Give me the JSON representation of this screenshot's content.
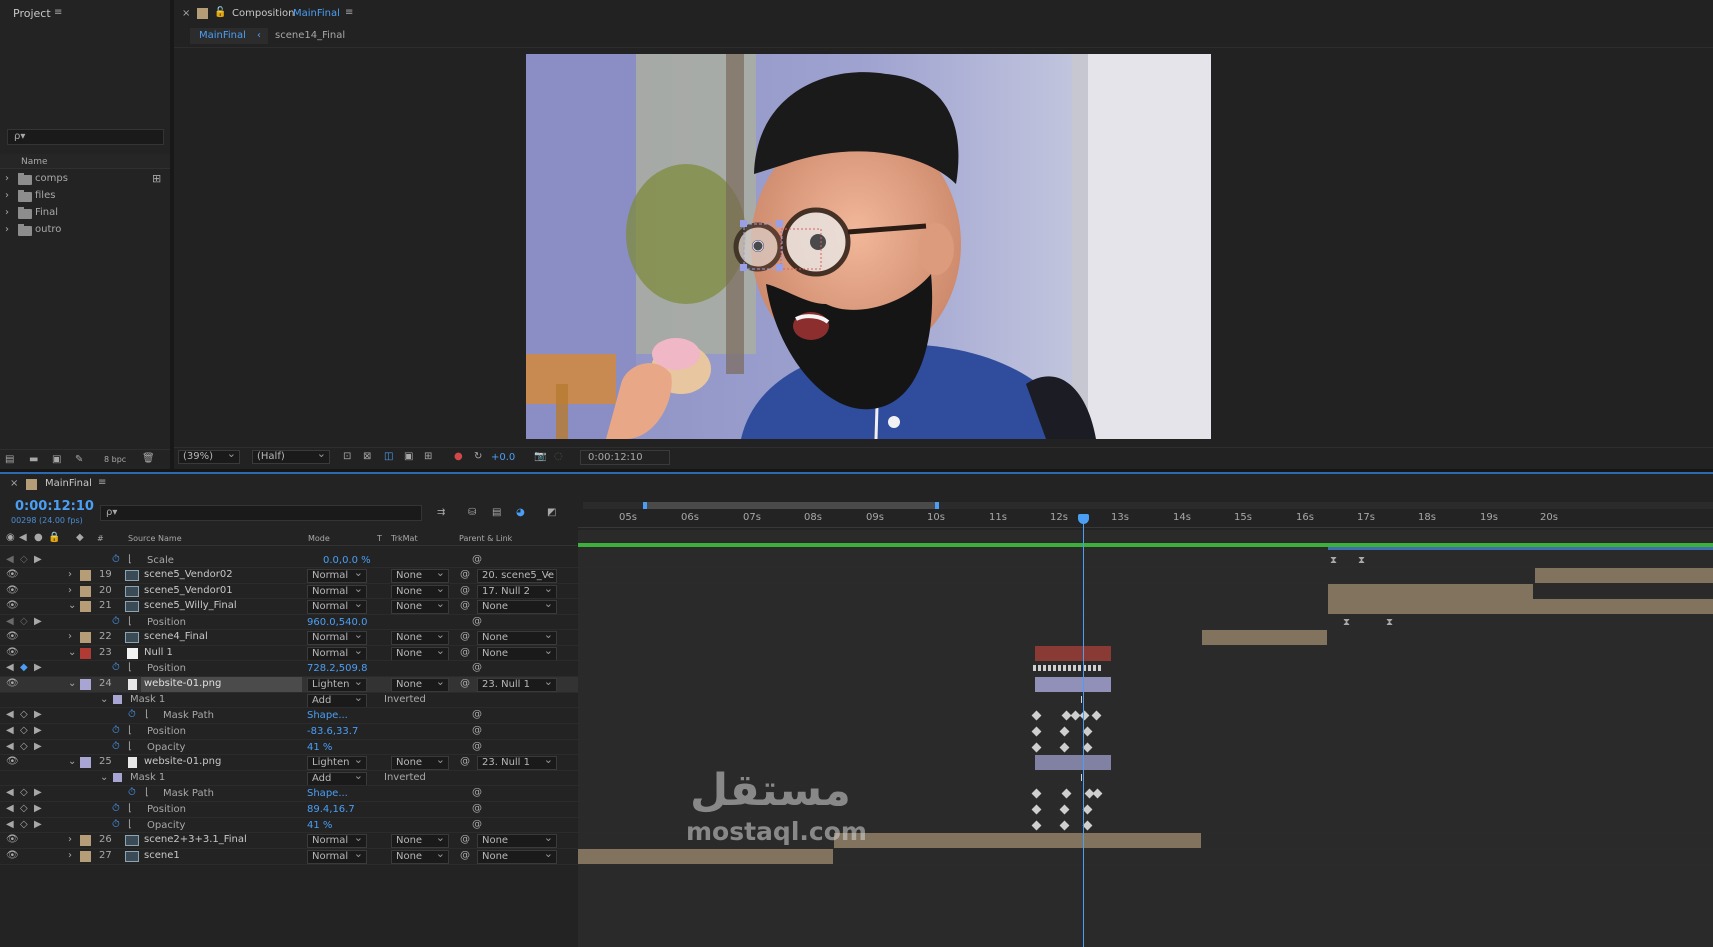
{
  "project": {
    "title": "Project",
    "search_placeholder": "ρ▾",
    "column_name": "Name",
    "items": [
      "comps",
      "files",
      "Final",
      "outro"
    ],
    "bpc": "8 bpc"
  },
  "composition": {
    "close": "×",
    "label": "Composition",
    "name": "MainFinal",
    "menu": "≡",
    "breadcrumb_active": "MainFinal",
    "breadcrumb_arrow": "‹",
    "breadcrumb_next": "scene14_Final",
    "zoom": "(39%)",
    "resolution": "(Half)",
    "exposure": "+0.0",
    "timecode": "0:00:12:10"
  },
  "timeline": {
    "close": "×",
    "tab_name": "MainFinal",
    "menu": "≡",
    "current_time": "0:00:12:10",
    "frames": "00298 (24.00 fps)",
    "search_placeholder": "ρ▾",
    "headers": {
      "number": "#",
      "source_name": "Source Name",
      "mode": "Mode",
      "t": "T",
      "trkmat": "TrkMat",
      "parent": "Parent & Link"
    },
    "ruler": [
      "05s",
      "06s",
      "07s",
      "08s",
      "09s",
      "10s",
      "11s",
      "12s",
      "13s",
      "14s",
      "15s",
      "16s",
      "17s",
      "18s",
      "19s",
      "20s"
    ],
    "rows": [
      {
        "kind": "prop",
        "name": "Scale",
        "value": "0.0,0.0 %"
      },
      {
        "kind": "layer",
        "num": "19",
        "name": "scene5_Vendor02",
        "mode": "Normal",
        "trkmat": "None",
        "parent": "20. scene5_Ve"
      },
      {
        "kind": "layer",
        "num": "20",
        "name": "scene5_Vendor01",
        "mode": "Normal",
        "trkmat": "None",
        "parent": "17. Null 2"
      },
      {
        "kind": "layer",
        "num": "21",
        "name": "scene5_Willy_Final",
        "mode": "Normal",
        "trkmat": "None",
        "parent": "None"
      },
      {
        "kind": "prop",
        "name": "Position",
        "value": "960.0,540.0"
      },
      {
        "kind": "layer",
        "num": "22",
        "name": "scene4_Final",
        "mode": "Normal",
        "trkmat": "None",
        "parent": "None"
      },
      {
        "kind": "layer",
        "num": "23",
        "name": "Null 1",
        "mode": "Normal",
        "trkmat": "None",
        "parent": "None"
      },
      {
        "kind": "prop",
        "name": "Position",
        "value": "728.2,509.8"
      },
      {
        "kind": "layer",
        "num": "24",
        "name": "website-01.png",
        "mode": "Lighten",
        "trkmat": "None",
        "parent": "23. Null 1"
      },
      {
        "kind": "mask",
        "name": "Mask 1",
        "mode": "Add",
        "inverted": "Inverted"
      },
      {
        "kind": "prop",
        "name": "Mask Path",
        "value": "Shape..."
      },
      {
        "kind": "prop",
        "name": "Position",
        "value": "-83.6,33.7"
      },
      {
        "kind": "prop",
        "name": "Opacity",
        "value": "41 %"
      },
      {
        "kind": "layer",
        "num": "25",
        "name": "website-01.png",
        "mode": "Lighten",
        "trkmat": "None",
        "parent": "23. Null 1"
      },
      {
        "kind": "mask",
        "name": "Mask 1",
        "mode": "Add",
        "inverted": "Inverted"
      },
      {
        "kind": "prop",
        "name": "Mask Path",
        "value": "Shape..."
      },
      {
        "kind": "prop",
        "name": "Position",
        "value": "89.4,16.7"
      },
      {
        "kind": "prop",
        "name": "Opacity",
        "value": "41 %"
      },
      {
        "kind": "layer",
        "num": "26",
        "name": "scene2+3+3.1_Final",
        "mode": "Normal",
        "trkmat": "None",
        "parent": "None"
      },
      {
        "kind": "layer",
        "num": "27",
        "name": "scene1",
        "mode": "Normal",
        "trkmat": "None",
        "parent": "None"
      }
    ]
  },
  "watermark": {
    "arabic": "مستقل",
    "latin": "mostaql.com"
  },
  "colors": {
    "accent": "#4a9ff5",
    "label_tan": "#b59d78",
    "label_red": "#b03a34",
    "label_lavender": "#a9a5d2",
    "clip_tan": "#82735f",
    "clip_red": "#8a3a34",
    "clip_lavender": "#9190b8"
  }
}
